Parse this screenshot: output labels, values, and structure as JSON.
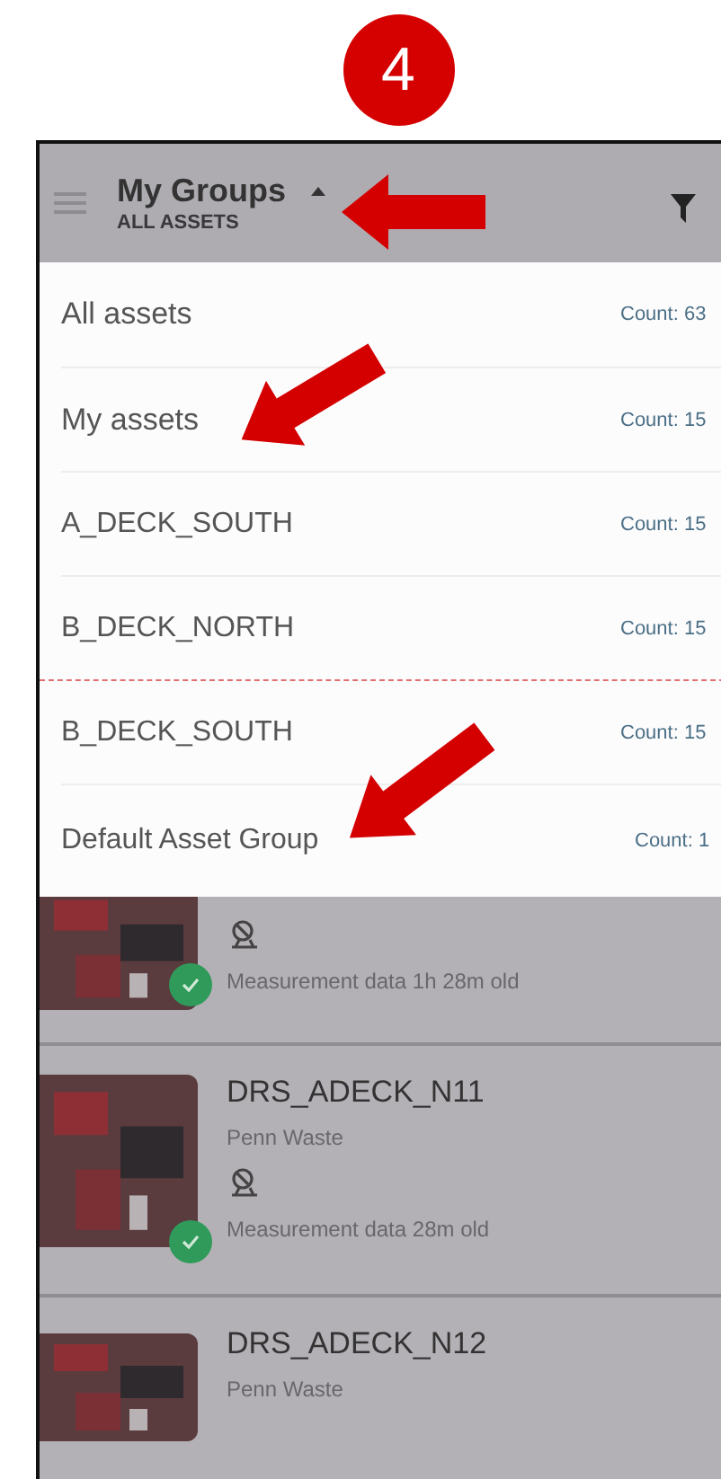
{
  "step_badge": "4",
  "app_bar": {
    "title": "My Groups",
    "subtitle": "ALL ASSETS",
    "dropdown_expanded": true
  },
  "group_menu": [
    {
      "name": "All assets",
      "count": "Count: 63"
    },
    {
      "name": "My assets",
      "count": "Count: 15"
    },
    {
      "name": "A_DECK_SOUTH",
      "count": "Count: 15"
    },
    {
      "name": "B_DECK_NORTH",
      "count": "Count: 15"
    },
    {
      "name": "B_DECK_SOUTH",
      "count": "Count: 15"
    },
    {
      "name": "Default Asset Group",
      "count": "Count: 1"
    }
  ],
  "assets": [
    {
      "kind": "partial",
      "status_ok": true,
      "status_text": "Measurement data 1h 28m old"
    },
    {
      "kind": "full",
      "name": "DRS_ADECK_N11",
      "owner": "Penn Waste",
      "status_ok": true,
      "status_text": "Measurement data 28m old"
    },
    {
      "kind": "cut",
      "name": "DRS_ADECK_N12",
      "owner": "Penn Waste"
    }
  ]
}
